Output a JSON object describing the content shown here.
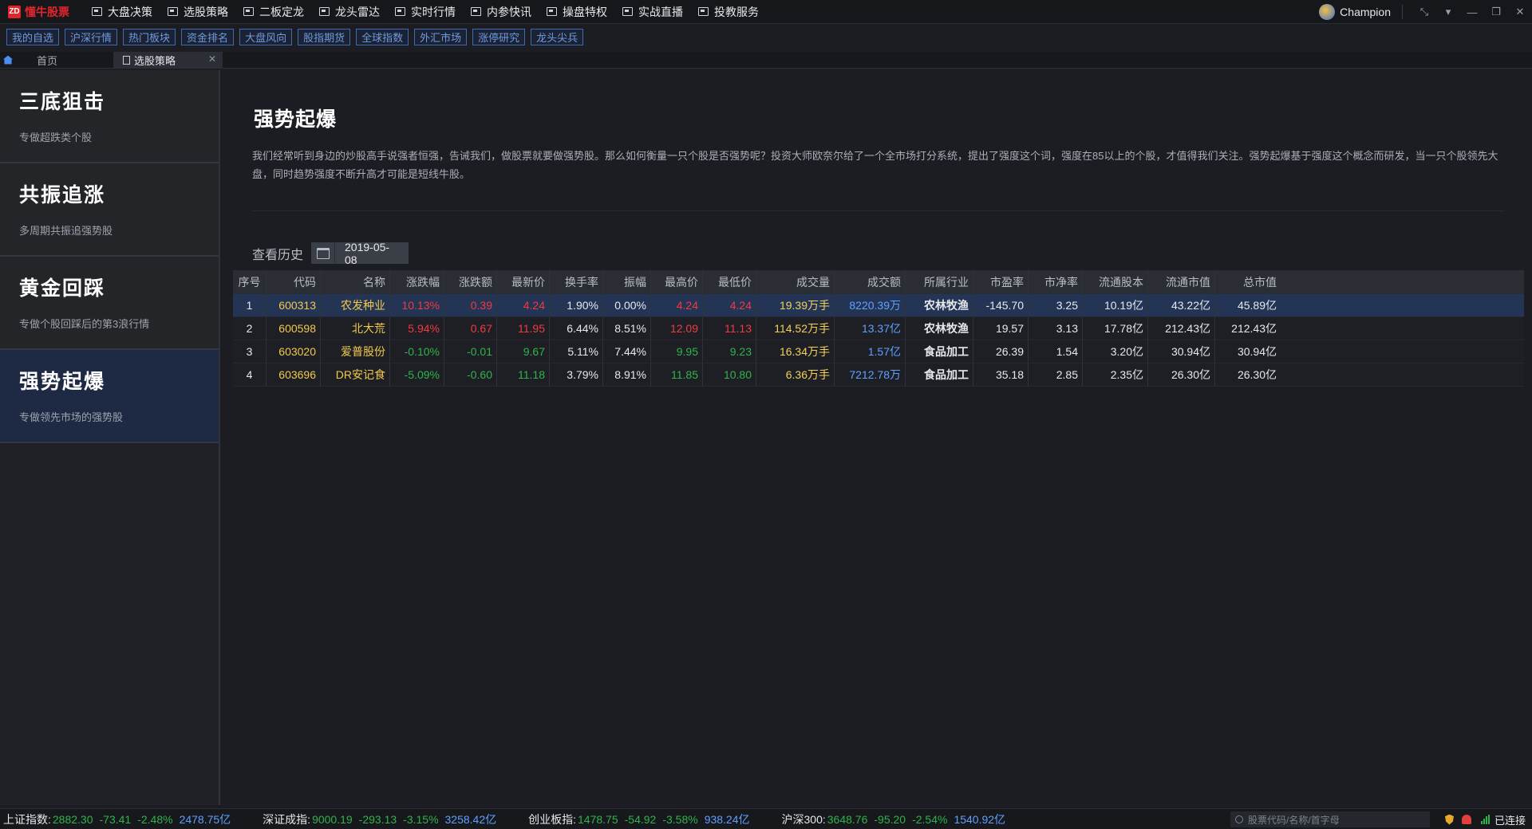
{
  "app": {
    "logo_mark": "ZD",
    "logo_text": "懂牛股票",
    "menu": [
      "大盘决策",
      "选股策略",
      "二板定龙",
      "龙头雷达",
      "实时行情",
      "内参快讯",
      "操盘特权",
      "实战直播",
      "投教服务"
    ],
    "user": "Champion",
    "window_controls": [
      "⤡",
      "▾",
      "—",
      "❐",
      "✕"
    ]
  },
  "tags": [
    "我的自选",
    "沪深行情",
    "热门板块",
    "资金排名",
    "大盘风向",
    "股指期货",
    "全球指数",
    "外汇市场",
    "涨停研究",
    "龙头尖兵"
  ],
  "tabs": {
    "home": "首页",
    "active": "选股策略",
    "close": "✕"
  },
  "sidebar": {
    "strategies": [
      {
        "title": "三底狙击",
        "desc": "专做超跌类个股"
      },
      {
        "title": "共振追涨",
        "desc": "多周期共振追强势股"
      },
      {
        "title": "黄金回踩",
        "desc": "专做个股回踩后的第3浪行情"
      },
      {
        "title": "强势起爆",
        "desc": "专做领先市场的强势股"
      }
    ],
    "active_index": 3
  },
  "main": {
    "title": "强势起爆",
    "description": "我们经常听到身边的炒股高手说强者恒强，告诫我们，做股票就要做强势股。那么如何衡量一只个股是否强势呢？投资大师欧奈尔给了一个全市场打分系统，提出了强度这个词，强度在85以上的个股，才值得我们关注。强势起爆基于强度这个概念而研发，当一只个股领先大盘，同时趋势强度不断升高才可能是短线牛股。",
    "history_label": "查看历史",
    "date": "2019-05-08"
  },
  "table": {
    "columns": [
      "序号",
      "代码",
      "名称",
      "涨跌幅",
      "涨跌额",
      "最新价",
      "换手率",
      "振幅",
      "最高价",
      "最低价",
      "成交量",
      "成交额",
      "所属行业",
      "市盈率",
      "市净率",
      "流通股本",
      "流通市值",
      "总市值"
    ],
    "rows": [
      {
        "cells": [
          "1",
          "600313",
          "农发种业",
          "10.13%",
          "0.39",
          "4.24",
          "1.90%",
          "0.00%",
          "4.24",
          "4.24",
          "19.39万手",
          "8220.39万",
          "农林牧渔",
          "-145.70",
          "3.25",
          "10.19亿",
          "43.22亿",
          "45.89亿"
        ],
        "dir": "up"
      },
      {
        "cells": [
          "2",
          "600598",
          "北大荒",
          "5.94%",
          "0.67",
          "11.95",
          "6.44%",
          "8.51%",
          "12.09",
          "11.13",
          "114.52万手",
          "13.37亿",
          "农林牧渔",
          "19.57",
          "3.13",
          "17.78亿",
          "212.43亿",
          "212.43亿"
        ],
        "dir": "up"
      },
      {
        "cells": [
          "3",
          "603020",
          "爱普股份",
          "-0.10%",
          "-0.01",
          "9.67",
          "5.11%",
          "7.44%",
          "9.95",
          "9.23",
          "16.34万手",
          "1.57亿",
          "食品加工",
          "26.39",
          "1.54",
          "3.20亿",
          "30.94亿",
          "30.94亿"
        ],
        "dir": "down"
      },
      {
        "cells": [
          "4",
          "603696",
          "DR安记食",
          "-5.09%",
          "-0.60",
          "11.18",
          "3.79%",
          "8.91%",
          "11.85",
          "10.80",
          "6.36万手",
          "7212.78万",
          "食品加工",
          "35.18",
          "2.85",
          "2.35亿",
          "26.30亿",
          "26.30亿"
        ],
        "dir": "down"
      }
    ]
  },
  "statusbar": {
    "indices": [
      {
        "name": "上证指数:",
        "price": "2882.30",
        "chg": "-73.41",
        "pct": "-2.48%",
        "amount": "2478.75亿"
      },
      {
        "name": "深证成指:",
        "price": "9000.19",
        "chg": "-293.13",
        "pct": "-3.15%",
        "amount": "3258.42亿"
      },
      {
        "name": "创业板指:",
        "price": "1478.75",
        "chg": "-54.92",
        "pct": "-3.58%",
        "amount": "938.24亿"
      },
      {
        "name": "沪深300:",
        "price": "3648.76",
        "chg": "-95.20",
        "pct": "-2.54%",
        "amount": "1540.92亿"
      }
    ],
    "search_placeholder": "股票代码/名称/首字母",
    "connection": "已连接"
  },
  "colors": {
    "up": "#f03a3f",
    "down": "#2fb44a",
    "accent": "#3d6ab3",
    "active_row": "#243455"
  }
}
